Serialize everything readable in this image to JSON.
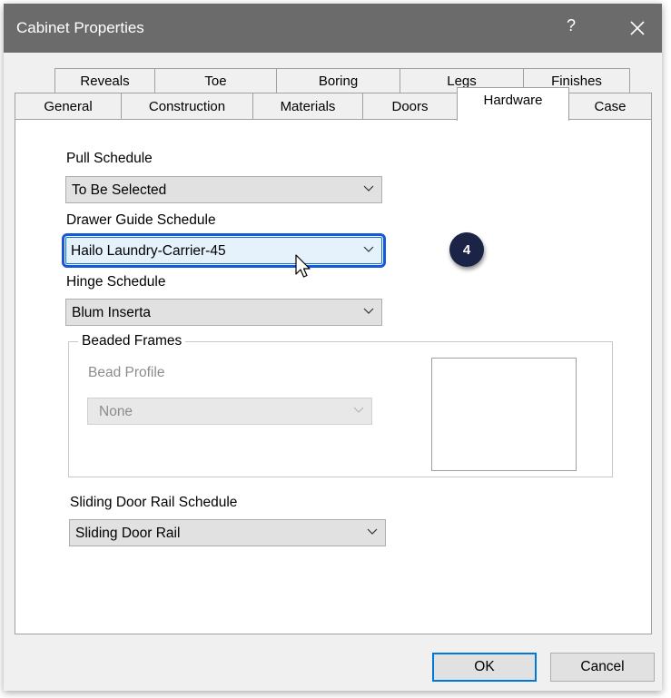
{
  "window": {
    "title": "Cabinet Properties",
    "help": "?",
    "close": "close"
  },
  "tabs": {
    "row1": [
      "Reveals",
      "Toe",
      "Boring",
      "Legs",
      "Finishes"
    ],
    "row2": [
      "General",
      "Construction",
      "Materials",
      "Doors",
      "Hardware",
      "Case"
    ],
    "active": "Hardware"
  },
  "fields": {
    "pull_schedule": {
      "label": "Pull Schedule",
      "value": "To Be Selected"
    },
    "drawer_guide_schedule": {
      "label": "Drawer Guide Schedule",
      "value": "Hailo Laundry-Carrier-45"
    },
    "hinge_schedule": {
      "label": "Hinge Schedule",
      "value": "Blum Inserta"
    },
    "beaded_frames": {
      "legend": "Beaded Frames",
      "bead_profile_label": "Bead Profile",
      "bead_profile_value": "None"
    },
    "sliding_door_rail_schedule": {
      "label": "Sliding Door Rail Schedule",
      "value": "Sliding Door Rail"
    }
  },
  "annotation": {
    "step": "4"
  },
  "buttons": {
    "ok": "OK",
    "cancel": "Cancel"
  },
  "colors": {
    "titlebar": "#6b6b6b",
    "focus_outline": "#1a56d6",
    "badge": "#1b2447",
    "default_button_border": "#0078d7"
  },
  "icons": {
    "close": "close-icon",
    "dropdown": "chevron-down-icon",
    "cursor": "mouse-pointer-icon"
  }
}
